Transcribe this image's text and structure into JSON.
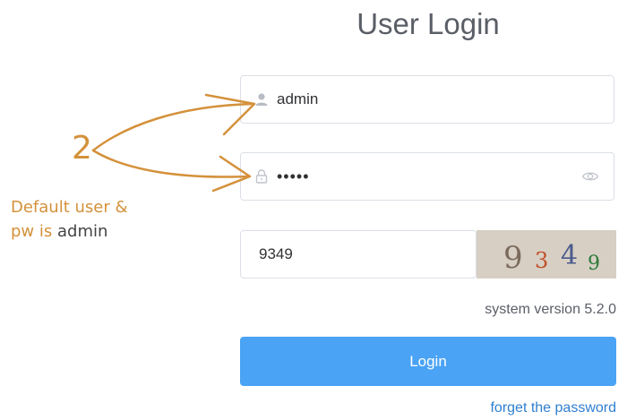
{
  "login": {
    "title": "User Login",
    "username_value": "admin",
    "password_value": "admin",
    "captcha_input_value": "9349",
    "captcha_digits": [
      "9",
      "3",
      "4",
      "9"
    ],
    "version_text": "system version 5.2.0",
    "login_button": "Login",
    "forget_link": "forget the password"
  },
  "annotation": {
    "step_number": "2",
    "line1": "Default user &",
    "line2_prefix": "pw is ",
    "line2_highlight": "admin"
  },
  "icons": {
    "username": "user-icon",
    "password": "lock-icon",
    "show_password": "eye-icon"
  },
  "colors": {
    "primary": "#4aa3f5",
    "link": "#2f7fd0",
    "annotation": "#d4913b",
    "captcha_bg": "#d7cfc4"
  }
}
